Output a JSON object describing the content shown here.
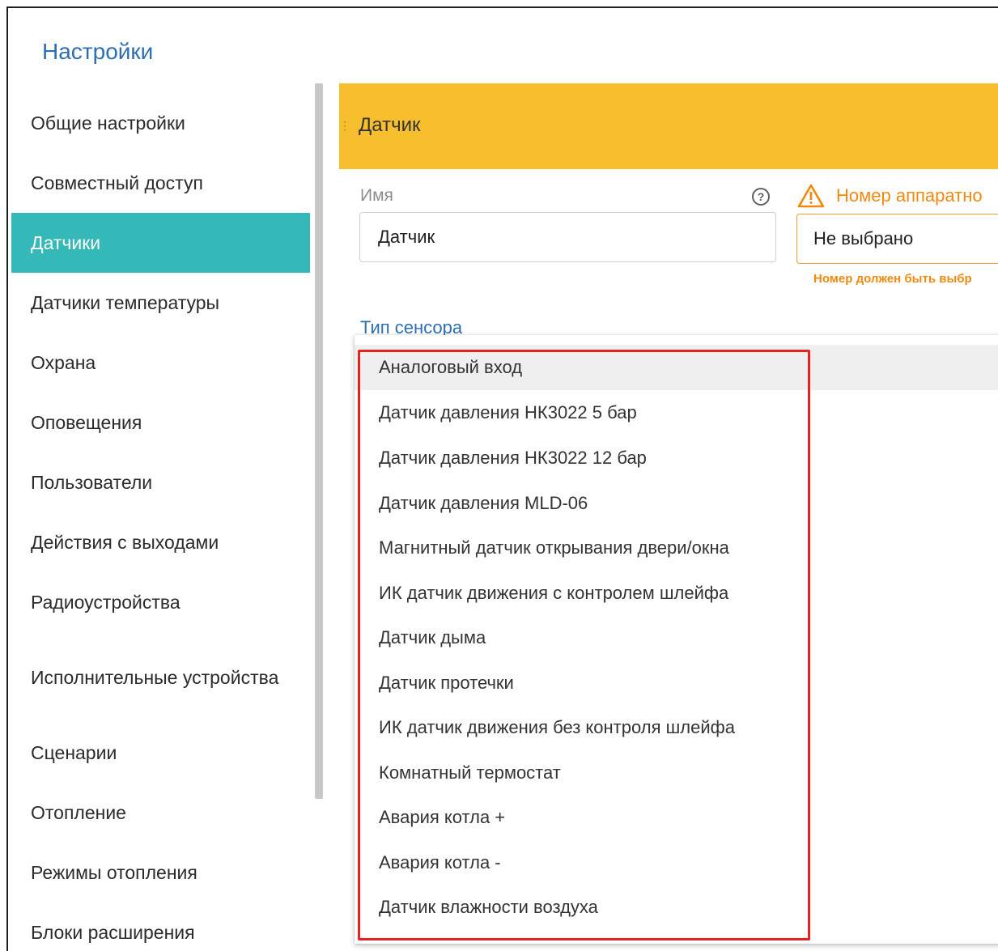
{
  "dialog": {
    "title": "Настройки"
  },
  "sidebar": {
    "items": [
      {
        "label": "Общие настройки"
      },
      {
        "label": "Совместный доступ"
      },
      {
        "label": "Датчики",
        "active": true
      },
      {
        "label": "Датчики температуры"
      },
      {
        "label": "Охрана"
      },
      {
        "label": "Оповещения"
      },
      {
        "label": "Пользователи"
      },
      {
        "label": "Действия с выходами"
      },
      {
        "label": "Радиоустройства"
      },
      {
        "label": "Исполнительные устройства"
      },
      {
        "label": "Сценарии"
      },
      {
        "label": "Отопление"
      },
      {
        "label": "Режимы отопления"
      },
      {
        "label": "Блоки расширения"
      }
    ]
  },
  "panel": {
    "header_title": "Датчик",
    "header_color": "#f7bf2e"
  },
  "form": {
    "name_label": "Имя",
    "name_value": "Датчик",
    "hardware_label": "Номер аппаратно",
    "hardware_value": "Не выбрано",
    "hardware_error": "Номер должен быть выбр",
    "sensor_type_label": "Тип сенсора"
  },
  "dropdown": {
    "options": [
      "Аналоговый вход",
      "Датчик давления НК3022 5 бар",
      "Датчик давления НК3022 12 бар",
      "Датчик давления MLD-06",
      "Магнитный датчик открывания двери/окна",
      "ИК датчик движения с контролем шлейфа",
      "Датчик дыма",
      "Датчик протечки",
      "ИК датчик движения без контроля шлейфа",
      "Комнатный термостат",
      "Авария котла +",
      "Авария котла -",
      "Датчик влажности воздуха"
    ],
    "selected": "Аналоговый вход"
  },
  "colors": {
    "accent": "#35b8b8",
    "title_blue": "#2e6fb4",
    "warning": "#f08a0e",
    "highlight": "#e52222"
  },
  "icons": {
    "help": "help-circle-icon",
    "warning": "warning-triangle-icon",
    "drag": "drag-handle-icon"
  }
}
